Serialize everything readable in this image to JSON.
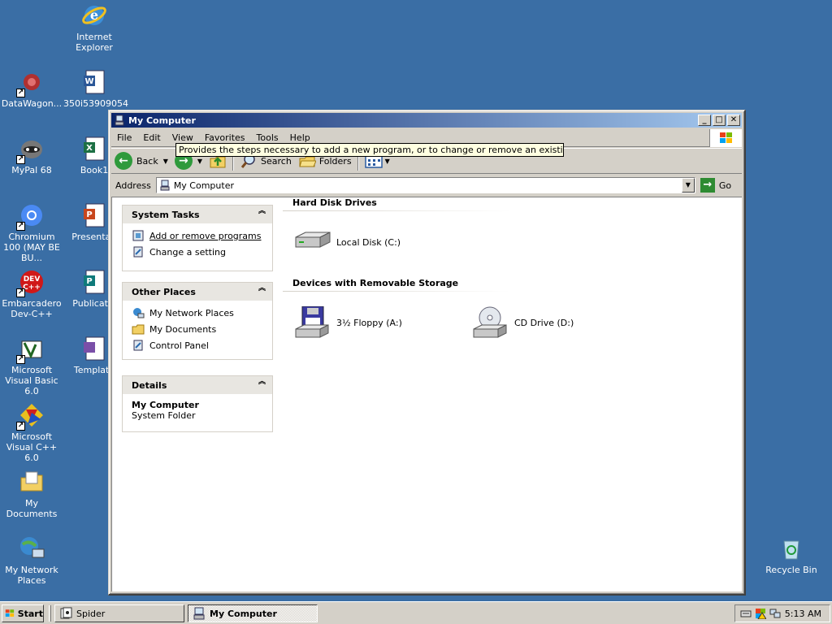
{
  "desktop": {
    "icons": [
      {
        "label": "Internet Explorer",
        "icon": "internet-explorer-icon"
      },
      {
        "label": "DataWagon...",
        "icon": "datawagon-icon"
      },
      {
        "label": "350i53909054",
        "icon": "word-document-icon"
      },
      {
        "label": "MyPal 68",
        "icon": "mypal-icon"
      },
      {
        "label": "Book1",
        "icon": "excel-workbook-icon"
      },
      {
        "label": "Chromium 100 (MAY BE BU...",
        "icon": "chromium-icon"
      },
      {
        "label": "Presentati",
        "icon": "powerpoint-icon"
      },
      {
        "label": "Embarcadero Dev-C++",
        "icon": "devcpp-icon"
      },
      {
        "label": "Publicatio",
        "icon": "publisher-icon"
      },
      {
        "label": "Microsoft Visual Basic 6.0",
        "icon": "visual-basic-icon"
      },
      {
        "label": "Template",
        "icon": "template-icon"
      },
      {
        "label": "Microsoft Visual C++ 6.0",
        "icon": "visual-cpp-icon"
      },
      {
        "label": "My Documents",
        "icon": "my-documents-icon"
      },
      {
        "label": "My Network Places",
        "icon": "network-places-icon"
      },
      {
        "label": "Recycle Bin",
        "icon": "recycle-bin-icon"
      }
    ]
  },
  "window": {
    "title": "My Computer",
    "menu": [
      "File",
      "Edit",
      "View",
      "Favorites",
      "Tools",
      "Help"
    ],
    "toolbar": {
      "back": "Back",
      "search": "Search",
      "folders": "Folders"
    },
    "address": {
      "label": "Address",
      "value": "My Computer",
      "go": "Go"
    }
  },
  "taskpane": {
    "system_tasks": {
      "title": "System Tasks",
      "links": [
        "Add or remove programs",
        "Change a setting"
      ]
    },
    "other_places": {
      "title": "Other Places",
      "links": [
        "My Network Places",
        "My Documents",
        "Control Panel"
      ]
    },
    "details": {
      "title": "Details",
      "name": "My Computer",
      "type": "System Folder"
    }
  },
  "main": {
    "hard_disks": {
      "title": "Hard Disk Drives",
      "items": [
        "Local Disk (C:)"
      ]
    },
    "removable": {
      "title": "Devices with Removable Storage",
      "items": [
        "3½ Floppy (A:)",
        "CD Drive (D:)"
      ]
    },
    "tooltip": "Provides the steps necessary to add a new program, or to change or remove an existing program."
  },
  "taskbar": {
    "start": "Start",
    "buttons": [
      "Spider",
      "My Computer"
    ],
    "clock": "5:13 AM"
  }
}
